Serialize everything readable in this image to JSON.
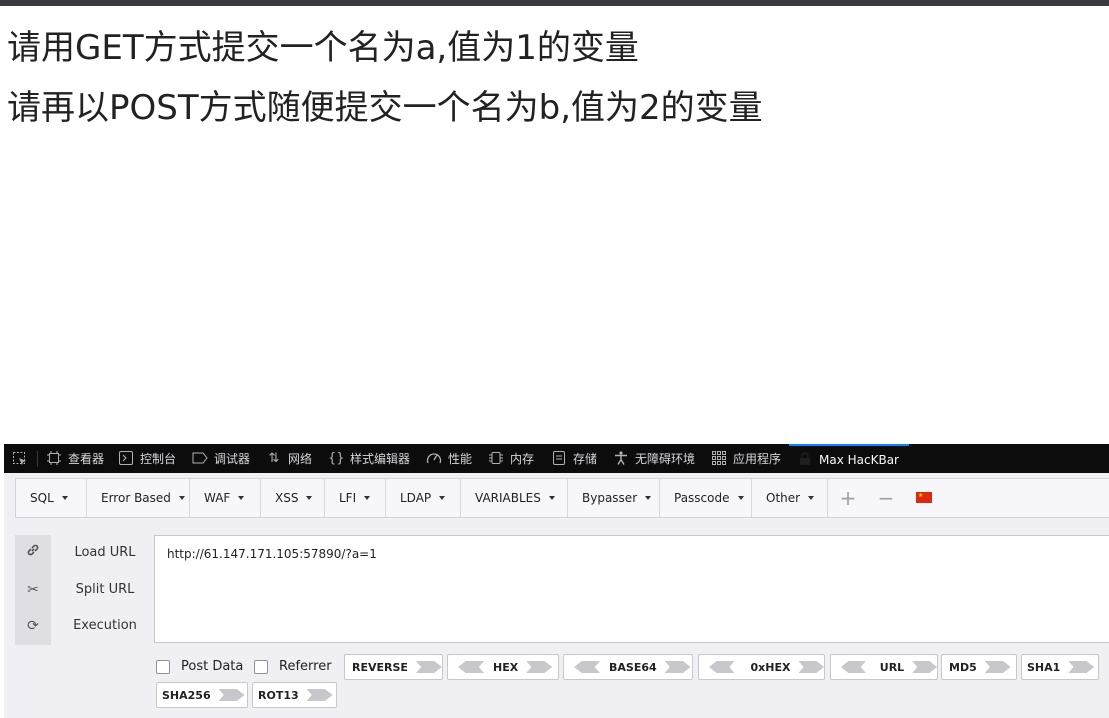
{
  "page": {
    "line1": "请用GET方式提交一个名为a,值为1的变量",
    "line2": "请再以POST方式随便提交一个名为b,值为2的变量"
  },
  "devtools": {
    "tabs": [
      {
        "label": "查看器",
        "icon": "inspector-icon"
      },
      {
        "label": "控制台",
        "icon": "console-icon"
      },
      {
        "label": "调试器",
        "icon": "debugger-icon"
      },
      {
        "label": "网络",
        "icon": "network-icon"
      },
      {
        "label": "样式编辑器",
        "icon": "style-editor-icon"
      },
      {
        "label": "性能",
        "icon": "performance-icon"
      },
      {
        "label": "内存",
        "icon": "memory-icon"
      },
      {
        "label": "存储",
        "icon": "storage-icon"
      },
      {
        "label": "无障碍环境",
        "icon": "accessibility-icon"
      },
      {
        "label": "应用程序",
        "icon": "application-icon"
      },
      {
        "label": "Max HacKBar",
        "icon": "hackbar-icon"
      }
    ],
    "accent": "#0a84ff"
  },
  "hackbar": {
    "menu": [
      "SQL",
      "Error Based",
      "WAF",
      "XSS",
      "LFI",
      "LDAP",
      "VARIABLES",
      "Bypasser",
      "Passcode",
      "Other"
    ],
    "plus": "+",
    "minus": "−",
    "side": {
      "load_url": "Load URL",
      "split_url": "Split URL",
      "execution": "Execution"
    },
    "url_value": "http://61.147.171.105:57890/?a=1",
    "post_data_label": "Post Data",
    "referrer_label": "Referrer",
    "encoders_row1": [
      "REVERSE",
      "HEX",
      "BASE64",
      "0xHEX",
      "URL",
      "MD5",
      "SHA1"
    ],
    "encoders_row2": [
      "SHA256",
      "ROT13"
    ]
  }
}
